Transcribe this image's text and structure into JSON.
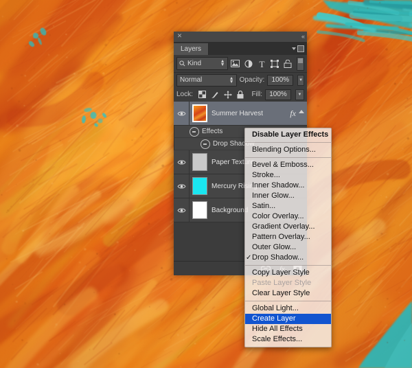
{
  "background": {
    "description": "orange-red acrylic paint texture with teal accents",
    "base_color": "#e8791c",
    "accent_colors": [
      "#ff8c1a",
      "#e23d12",
      "#f5a623",
      "#1fc8d0",
      "#c9341a"
    ]
  },
  "panel": {
    "title_tab": "Layers",
    "close_icon": "close-icon",
    "collapse_icon": "collapse-icon",
    "filter": {
      "kind_label": "Kind",
      "search_icon": "search-icon",
      "icons": [
        "image-filter-icon",
        "adjustment-filter-icon",
        "type-filter-icon",
        "shape-filter-icon",
        "smartobject-filter-icon"
      ],
      "toggle_name": "filter-enable-toggle"
    },
    "blend": {
      "mode": "Normal",
      "opacity_label": "Opacity:",
      "opacity_value": "100%"
    },
    "lock": {
      "label": "Lock:",
      "icons": [
        "lock-transparent-icon",
        "lock-image-icon",
        "lock-position-icon",
        "lock-all-icon"
      ],
      "fill_label": "Fill:",
      "fill_value": "100%"
    },
    "layers": [
      {
        "name": "Summer Harvest",
        "visible": true,
        "selected": true,
        "thumb_type": "image",
        "thumb_color": "#e8731a",
        "has_fx": true,
        "fx_label": "fx",
        "effects": [
          {
            "name": "Effects",
            "level": 1
          },
          {
            "name": "Drop Shadow",
            "level": 2
          }
        ]
      },
      {
        "name": "Paper Texture",
        "visible": true,
        "selected": false,
        "thumb_type": "solid",
        "thumb_color": "#c9c9c9",
        "has_fx": false,
        "effects": []
      },
      {
        "name": "Mercury Rising",
        "visible": true,
        "selected": false,
        "thumb_type": "solid",
        "thumb_color": "#1ae6f0",
        "has_fx": false,
        "effects": []
      },
      {
        "name": "Background",
        "visible": true,
        "selected": false,
        "thumb_type": "solid",
        "thumb_color": "#ffffff",
        "has_fx": false,
        "effects": []
      }
    ],
    "footer_icons": [
      "link-layers-icon",
      "add-layer-style-icon",
      "add-layer-mask-icon"
    ]
  },
  "context_menu": {
    "items": [
      {
        "label": "Disable Layer Effects",
        "style": "bold",
        "checked": false,
        "separator_after": true
      },
      {
        "label": "Blending Options...",
        "style": "normal",
        "checked": false,
        "separator_after": true
      },
      {
        "label": "Bevel & Emboss...",
        "style": "normal",
        "checked": false,
        "separator_after": false
      },
      {
        "label": "Stroke...",
        "style": "normal",
        "checked": false,
        "separator_after": false
      },
      {
        "label": "Inner Shadow...",
        "style": "normal",
        "checked": false,
        "separator_after": false
      },
      {
        "label": "Inner Glow...",
        "style": "normal",
        "checked": false,
        "separator_after": false
      },
      {
        "label": "Satin...",
        "style": "normal",
        "checked": false,
        "separator_after": false
      },
      {
        "label": "Color Overlay...",
        "style": "normal",
        "checked": false,
        "separator_after": false
      },
      {
        "label": "Gradient Overlay...",
        "style": "normal",
        "checked": false,
        "separator_after": false
      },
      {
        "label": "Pattern Overlay...",
        "style": "normal",
        "checked": false,
        "separator_after": false
      },
      {
        "label": "Outer Glow...",
        "style": "normal",
        "checked": false,
        "separator_after": false
      },
      {
        "label": "Drop Shadow...",
        "style": "normal",
        "checked": true,
        "separator_after": true
      },
      {
        "label": "Copy Layer Style",
        "style": "normal",
        "checked": false,
        "separator_after": false
      },
      {
        "label": "Paste Layer Style",
        "style": "disabled",
        "checked": false,
        "separator_after": false
      },
      {
        "label": "Clear Layer Style",
        "style": "normal",
        "checked": false,
        "separator_after": true
      },
      {
        "label": "Global Light...",
        "style": "normal",
        "checked": false,
        "separator_after": false
      },
      {
        "label": "Create Layer",
        "style": "highlight",
        "checked": false,
        "separator_after": false
      },
      {
        "label": "Hide All Effects",
        "style": "normal",
        "checked": false,
        "separator_after": false
      },
      {
        "label": "Scale Effects...",
        "style": "normal",
        "checked": false,
        "separator_after": false
      }
    ],
    "highlight_color": "#1254cf",
    "check_glyph": "✓"
  }
}
